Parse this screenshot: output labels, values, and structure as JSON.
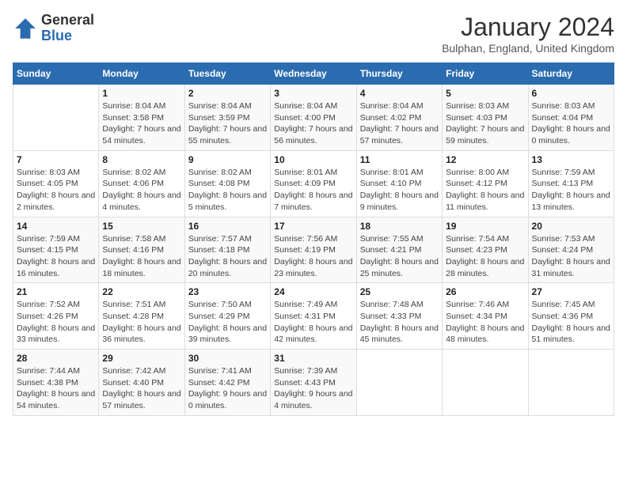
{
  "logo": {
    "general": "General",
    "blue": "Blue"
  },
  "title": "January 2024",
  "location": "Bulphan, England, United Kingdom",
  "days_of_week": [
    "Sunday",
    "Monday",
    "Tuesday",
    "Wednesday",
    "Thursday",
    "Friday",
    "Saturday"
  ],
  "weeks": [
    [
      {
        "day": "",
        "sunrise": "",
        "sunset": "",
        "daylight": ""
      },
      {
        "day": "1",
        "sunrise": "Sunrise: 8:04 AM",
        "sunset": "Sunset: 3:58 PM",
        "daylight": "Daylight: 7 hours and 54 minutes."
      },
      {
        "day": "2",
        "sunrise": "Sunrise: 8:04 AM",
        "sunset": "Sunset: 3:59 PM",
        "daylight": "Daylight: 7 hours and 55 minutes."
      },
      {
        "day": "3",
        "sunrise": "Sunrise: 8:04 AM",
        "sunset": "Sunset: 4:00 PM",
        "daylight": "Daylight: 7 hours and 56 minutes."
      },
      {
        "day": "4",
        "sunrise": "Sunrise: 8:04 AM",
        "sunset": "Sunset: 4:02 PM",
        "daylight": "Daylight: 7 hours and 57 minutes."
      },
      {
        "day": "5",
        "sunrise": "Sunrise: 8:03 AM",
        "sunset": "Sunset: 4:03 PM",
        "daylight": "Daylight: 7 hours and 59 minutes."
      },
      {
        "day": "6",
        "sunrise": "Sunrise: 8:03 AM",
        "sunset": "Sunset: 4:04 PM",
        "daylight": "Daylight: 8 hours and 0 minutes."
      }
    ],
    [
      {
        "day": "7",
        "sunrise": "Sunrise: 8:03 AM",
        "sunset": "Sunset: 4:05 PM",
        "daylight": "Daylight: 8 hours and 2 minutes."
      },
      {
        "day": "8",
        "sunrise": "Sunrise: 8:02 AM",
        "sunset": "Sunset: 4:06 PM",
        "daylight": "Daylight: 8 hours and 4 minutes."
      },
      {
        "day": "9",
        "sunrise": "Sunrise: 8:02 AM",
        "sunset": "Sunset: 4:08 PM",
        "daylight": "Daylight: 8 hours and 5 minutes."
      },
      {
        "day": "10",
        "sunrise": "Sunrise: 8:01 AM",
        "sunset": "Sunset: 4:09 PM",
        "daylight": "Daylight: 8 hours and 7 minutes."
      },
      {
        "day": "11",
        "sunrise": "Sunrise: 8:01 AM",
        "sunset": "Sunset: 4:10 PM",
        "daylight": "Daylight: 8 hours and 9 minutes."
      },
      {
        "day": "12",
        "sunrise": "Sunrise: 8:00 AM",
        "sunset": "Sunset: 4:12 PM",
        "daylight": "Daylight: 8 hours and 11 minutes."
      },
      {
        "day": "13",
        "sunrise": "Sunrise: 7:59 AM",
        "sunset": "Sunset: 4:13 PM",
        "daylight": "Daylight: 8 hours and 13 minutes."
      }
    ],
    [
      {
        "day": "14",
        "sunrise": "Sunrise: 7:59 AM",
        "sunset": "Sunset: 4:15 PM",
        "daylight": "Daylight: 8 hours and 16 minutes."
      },
      {
        "day": "15",
        "sunrise": "Sunrise: 7:58 AM",
        "sunset": "Sunset: 4:16 PM",
        "daylight": "Daylight: 8 hours and 18 minutes."
      },
      {
        "day": "16",
        "sunrise": "Sunrise: 7:57 AM",
        "sunset": "Sunset: 4:18 PM",
        "daylight": "Daylight: 8 hours and 20 minutes."
      },
      {
        "day": "17",
        "sunrise": "Sunrise: 7:56 AM",
        "sunset": "Sunset: 4:19 PM",
        "daylight": "Daylight: 8 hours and 23 minutes."
      },
      {
        "day": "18",
        "sunrise": "Sunrise: 7:55 AM",
        "sunset": "Sunset: 4:21 PM",
        "daylight": "Daylight: 8 hours and 25 minutes."
      },
      {
        "day": "19",
        "sunrise": "Sunrise: 7:54 AM",
        "sunset": "Sunset: 4:23 PM",
        "daylight": "Daylight: 8 hours and 28 minutes."
      },
      {
        "day": "20",
        "sunrise": "Sunrise: 7:53 AM",
        "sunset": "Sunset: 4:24 PM",
        "daylight": "Daylight: 8 hours and 31 minutes."
      }
    ],
    [
      {
        "day": "21",
        "sunrise": "Sunrise: 7:52 AM",
        "sunset": "Sunset: 4:26 PM",
        "daylight": "Daylight: 8 hours and 33 minutes."
      },
      {
        "day": "22",
        "sunrise": "Sunrise: 7:51 AM",
        "sunset": "Sunset: 4:28 PM",
        "daylight": "Daylight: 8 hours and 36 minutes."
      },
      {
        "day": "23",
        "sunrise": "Sunrise: 7:50 AM",
        "sunset": "Sunset: 4:29 PM",
        "daylight": "Daylight: 8 hours and 39 minutes."
      },
      {
        "day": "24",
        "sunrise": "Sunrise: 7:49 AM",
        "sunset": "Sunset: 4:31 PM",
        "daylight": "Daylight: 8 hours and 42 minutes."
      },
      {
        "day": "25",
        "sunrise": "Sunrise: 7:48 AM",
        "sunset": "Sunset: 4:33 PM",
        "daylight": "Daylight: 8 hours and 45 minutes."
      },
      {
        "day": "26",
        "sunrise": "Sunrise: 7:46 AM",
        "sunset": "Sunset: 4:34 PM",
        "daylight": "Daylight: 8 hours and 48 minutes."
      },
      {
        "day": "27",
        "sunrise": "Sunrise: 7:45 AM",
        "sunset": "Sunset: 4:36 PM",
        "daylight": "Daylight: 8 hours and 51 minutes."
      }
    ],
    [
      {
        "day": "28",
        "sunrise": "Sunrise: 7:44 AM",
        "sunset": "Sunset: 4:38 PM",
        "daylight": "Daylight: 8 hours and 54 minutes."
      },
      {
        "day": "29",
        "sunrise": "Sunrise: 7:42 AM",
        "sunset": "Sunset: 4:40 PM",
        "daylight": "Daylight: 8 hours and 57 minutes."
      },
      {
        "day": "30",
        "sunrise": "Sunrise: 7:41 AM",
        "sunset": "Sunset: 4:42 PM",
        "daylight": "Daylight: 9 hours and 0 minutes."
      },
      {
        "day": "31",
        "sunrise": "Sunrise: 7:39 AM",
        "sunset": "Sunset: 4:43 PM",
        "daylight": "Daylight: 9 hours and 4 minutes."
      },
      {
        "day": "",
        "sunrise": "",
        "sunset": "",
        "daylight": ""
      },
      {
        "day": "",
        "sunrise": "",
        "sunset": "",
        "daylight": ""
      },
      {
        "day": "",
        "sunrise": "",
        "sunset": "",
        "daylight": ""
      }
    ]
  ]
}
